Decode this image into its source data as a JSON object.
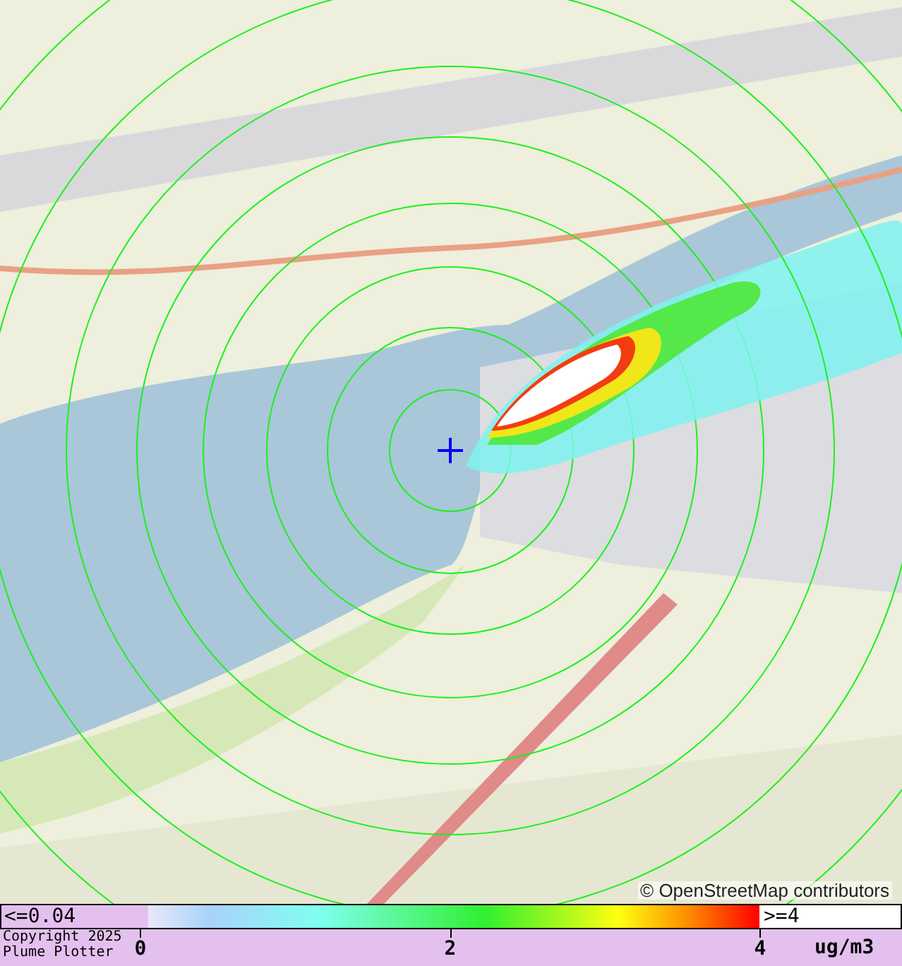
{
  "map": {
    "attribution": "© OpenStreetMap contributors"
  },
  "legend": {
    "min_label": "<=0.04",
    "max_label": ">=4",
    "ticks": [
      "0",
      "2",
      "4"
    ],
    "unit": "ug/m3"
  },
  "footer": {
    "copyright": [
      "Copyright 2025",
      "Plume Plotter"
    ]
  }
}
